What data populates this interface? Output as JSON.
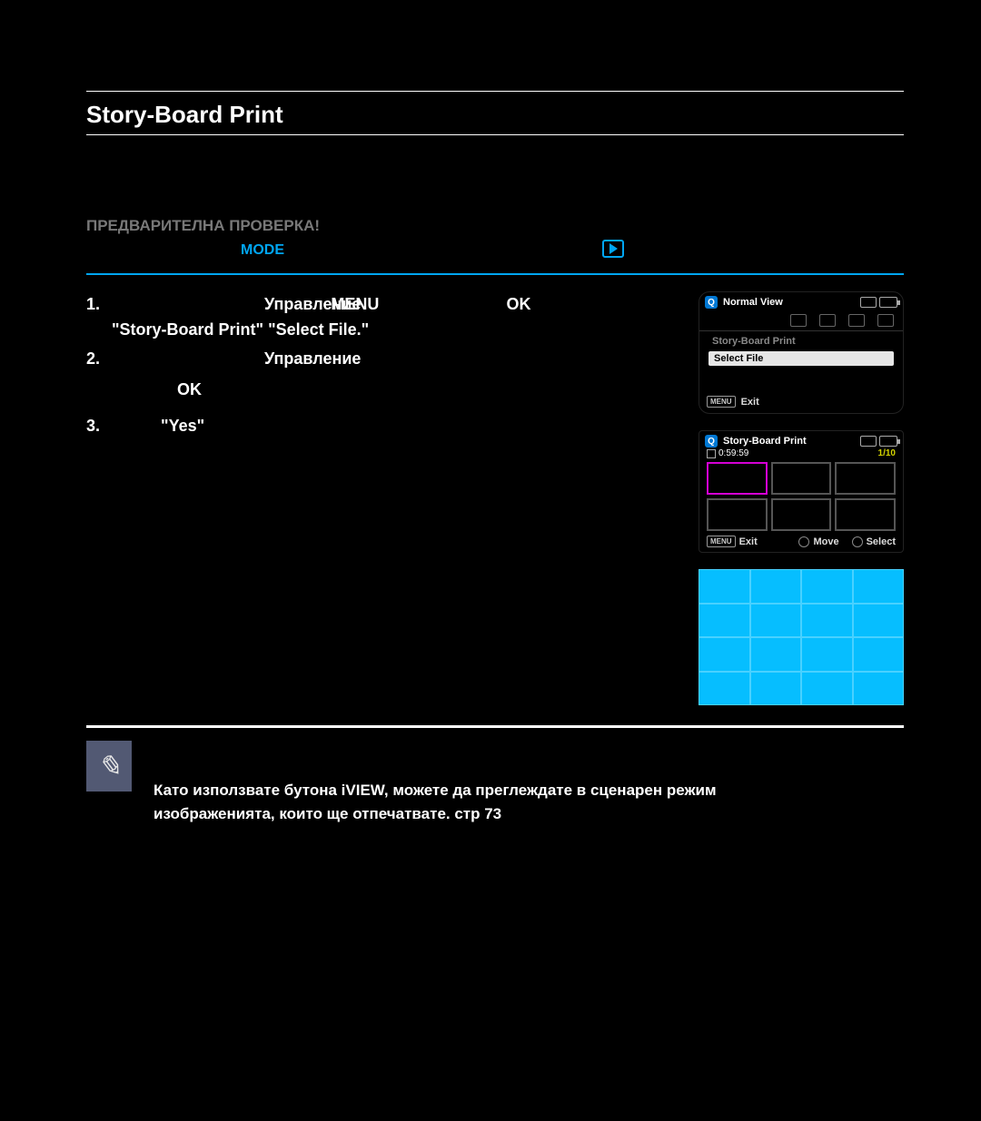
{
  "section_title": "Story-Board Print",
  "precheck_label": "ПРЕДВАРИТЕЛНА ПРОВЕРКА!",
  "mode_label": "MODE",
  "steps": {
    "s1_num": "1.",
    "s1_a": "Управление",
    "s1_menu": "MENU",
    "s1_ok": "OK",
    "s1_line2": "\"Story-Board Print\"  \"Select File.\"",
    "s2_num": "2.",
    "s2_a": "Управление",
    "s2_ok": "OK",
    "s3_num": "3.",
    "s3_a": "\"Yes\""
  },
  "screen1": {
    "badge": "Q",
    "title": "Normal View",
    "item": "Story-Board Print",
    "select": "Select File",
    "menu": "MENU",
    "exit": "Exit"
  },
  "screen2": {
    "badge": "Q",
    "title": "Story-Board Print",
    "time": "0:59:59",
    "page": "1/10",
    "menu": "MENU",
    "exit": "Exit",
    "move": "Move",
    "select": "Select"
  },
  "note_text": "Като използвате бутона iVIEW, можете да преглеждате в сценарен режим изображенията, които ще отпечатвате. стр 73"
}
